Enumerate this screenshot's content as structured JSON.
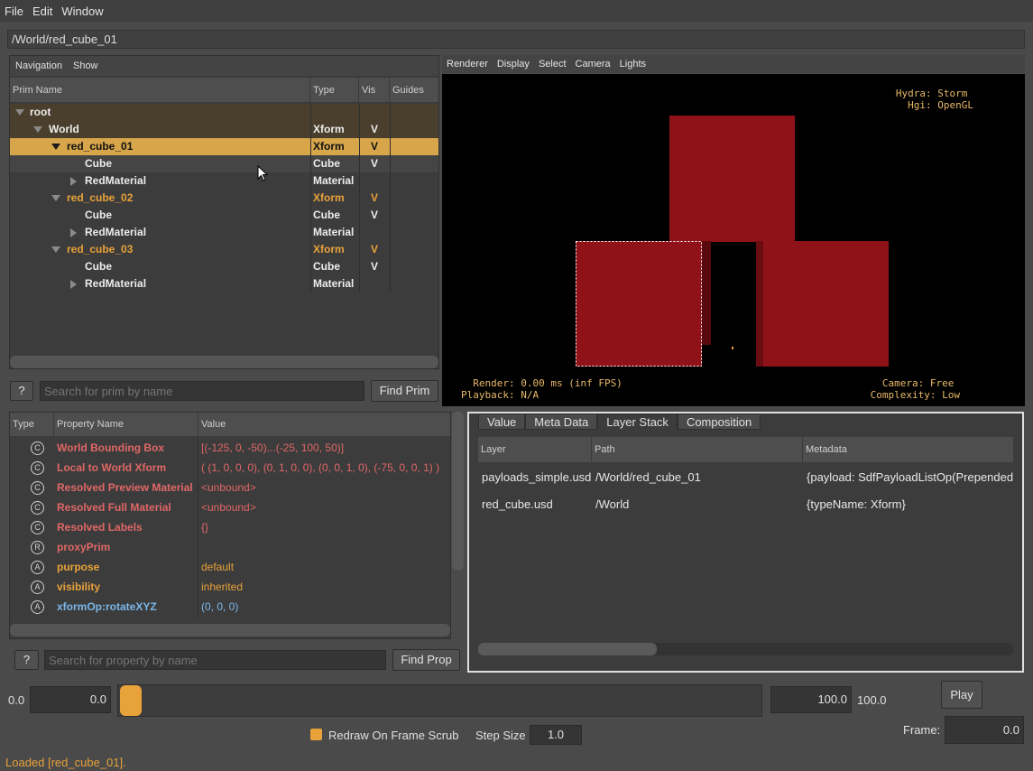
{
  "menubar": {
    "file": "File",
    "edit": "Edit",
    "window": "Window"
  },
  "path": "/World/red_cube_01",
  "navigation": {
    "menus": [
      "Navigation",
      "Show"
    ],
    "columns": [
      "Prim Name",
      "Type",
      "Vis",
      "Guides"
    ],
    "rows": [
      {
        "name": "root",
        "type": "",
        "vis": ""
      },
      {
        "name": "World",
        "type": "Xform",
        "vis": "V"
      },
      {
        "name": "red_cube_01",
        "type": "Xform",
        "vis": "V"
      },
      {
        "name": "Cube",
        "type": "Cube",
        "vis": "V"
      },
      {
        "name": "RedMaterial",
        "type": "Material",
        "vis": ""
      },
      {
        "name": "red_cube_02",
        "type": "Xform",
        "vis": "V"
      },
      {
        "name": "Cube",
        "type": "Cube",
        "vis": "V"
      },
      {
        "name": "RedMaterial",
        "type": "Material",
        "vis": ""
      },
      {
        "name": "red_cube_03",
        "type": "Xform",
        "vis": "V"
      },
      {
        "name": "Cube",
        "type": "Cube",
        "vis": "V"
      },
      {
        "name": "RedMaterial",
        "type": "Material",
        "vis": ""
      }
    ],
    "help": "?",
    "search_placeholder": "Search for prim by name",
    "find_button": "Find Prim"
  },
  "viewport": {
    "menus": [
      "Renderer",
      "Display",
      "Select",
      "Camera",
      "Lights"
    ],
    "hud_top_right": "Hydra: Storm\n  Hgi: OpenGL",
    "hud_bottom_left": "  Render: 0.00 ms (inf FPS)\nPlayback: N/A",
    "hud_bottom_right": "  Camera: Free\nComplexity: Low",
    "cube_color": "#8f1219"
  },
  "properties": {
    "columns": [
      "Type",
      "Property Name",
      "Value"
    ],
    "rows": [
      {
        "icon": "C",
        "name": "World Bounding Box",
        "value": "[(-125, 0, -50)...(-25, 100, 50)]"
      },
      {
        "icon": "C",
        "name": "Local to World Xform",
        "value": "( (1, 0, 0, 0), (0, 1, 0, 0), (0, 0, 1, 0), (-75, 0, 0, 1) )"
      },
      {
        "icon": "C",
        "name": "Resolved Preview Material",
        "value": "<unbound>"
      },
      {
        "icon": "C",
        "name": "Resolved Full Material",
        "value": "<unbound>"
      },
      {
        "icon": "C",
        "name": "Resolved Labels",
        "value": "{}"
      },
      {
        "icon": "R",
        "name": "proxyPrim",
        "value": ""
      },
      {
        "icon": "A",
        "name": "purpose",
        "value": "default"
      },
      {
        "icon": "A",
        "name": "visibility",
        "value": "inherited"
      },
      {
        "icon": "A",
        "name": "xformOp:rotateXYZ",
        "value": "(0, 0, 0)"
      }
    ],
    "help": "?",
    "search_placeholder": "Search for property by name",
    "find_button": "Find Prop"
  },
  "layerstack": {
    "tabs": [
      "Value",
      "Meta Data",
      "Layer Stack",
      "Composition"
    ],
    "columns": [
      "Layer",
      "Path",
      "Metadata"
    ],
    "rows": [
      {
        "layer": "payloads_simple.usd",
        "path": "/World/red_cube_01",
        "metadata": "{payload: SdfPayloadListOp(Prepended Ite"
      },
      {
        "layer": "red_cube.usd",
        "path": "/World",
        "metadata": "{typeName: Xform}"
      }
    ]
  },
  "timeline": {
    "start_label": "0.0",
    "start_value": "0.0",
    "end_value": "100.0",
    "end_label": "100.0",
    "play_button": "Play",
    "redraw_label": "Redraw On Frame Scrub",
    "step_label": "Step Size",
    "step_value": "1.0",
    "frame_label": "Frame:",
    "frame_value": "0.0",
    "accent": "#e8a23a"
  },
  "status": "Loaded [red_cube_01]."
}
